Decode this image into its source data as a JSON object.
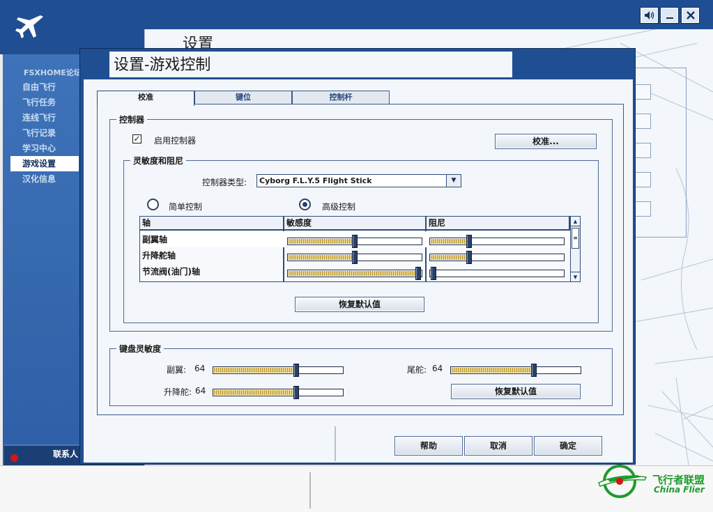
{
  "app": {
    "background_title": "设置",
    "logo_icon": "airplane-icon",
    "window_buttons": [
      {
        "name": "sound-icon",
        "glyph": "◀)"
      },
      {
        "name": "minimize-icon",
        "glyph": "_"
      },
      {
        "name": "close-icon",
        "glyph": "✕"
      }
    ]
  },
  "sidebar": {
    "header": "FSXHOME论坛",
    "items": [
      {
        "label": "自由飞行",
        "active": false
      },
      {
        "label": "飞行任务",
        "active": false
      },
      {
        "label": "连线飞行",
        "active": false
      },
      {
        "label": "飞行记录",
        "active": false
      },
      {
        "label": "学习中心",
        "active": false
      },
      {
        "label": "游戏设置",
        "active": true
      },
      {
        "label": "汉化信息",
        "active": false
      }
    ],
    "contact_label": "联系人"
  },
  "dialog": {
    "title": "设置-游戏控制",
    "tabs": [
      {
        "label": "校准",
        "active": true
      },
      {
        "label": "键位",
        "active": false
      },
      {
        "label": "控制杆",
        "active": false
      }
    ],
    "controller": {
      "legend": "控制器",
      "enable_label": "启用控制器",
      "enable_checked": true,
      "calibrate_button": "校准...",
      "sensitivity": {
        "legend": "灵敏度和阻尼",
        "type_label": "控制器类型:",
        "type_value": "Cyborg F.L.Y.5 Flight Stick",
        "mode_simple": "简单控制",
        "mode_advanced": "高级控制",
        "selected_mode": "advanced",
        "table": {
          "headers": [
            "轴",
            "敏感度",
            "阻尼"
          ],
          "rows": [
            {
              "name": "副翼轴",
              "sensitivity": 0.5,
              "damping": 0.29
            },
            {
              "name": "升降舵轴",
              "sensitivity": 0.5,
              "damping": 0.29
            },
            {
              "name": "节流阀(油门)轴",
              "sensitivity": 1.0,
              "damping": 0.0
            }
          ]
        },
        "reset_button": "恢复默认值"
      }
    },
    "keyboard": {
      "legend": "键盘灵敏度",
      "aileron_label": "副翼:",
      "aileron_value": "64",
      "aileron_level": 0.64,
      "rudder_label": "尾舵:",
      "rudder_value": "64",
      "rudder_level": 0.64,
      "elevator_label": "升降舵:",
      "elevator_value": "64",
      "elevator_level": 0.64,
      "reset_button": "恢复默认值"
    },
    "footer": {
      "help": "帮助",
      "cancel": "取消",
      "ok": "确定"
    }
  },
  "watermark": {
    "title": "飞行者联盟",
    "subtitle": "China Flier"
  },
  "colors": {
    "frame_blue": "#1f4f92",
    "panel_bg": "#f3f6fa",
    "slider_fill": "#c8a646",
    "watermark_green": "#1f9a2f"
  }
}
